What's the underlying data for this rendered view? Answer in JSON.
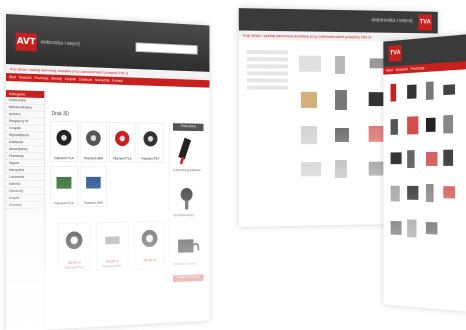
{
  "brand": {
    "logo_text": "AVT",
    "tagline": "elektronika i więcej",
    "badge": "TVA",
    "colors": {
      "accent": "#c8201e",
      "header": "#3a3a3a"
    }
  },
  "left_page": {
    "promo": "Kup teraz i zyskaj darmową dostawę przy zamówieniach powyżej 150 zł",
    "nav": [
      "Start",
      "Nowości",
      "Promocje",
      "Moduły",
      "Czujniki",
      "Zasilacze",
      "Narzędzia",
      "Kontakt"
    ],
    "sidebar_title": "Kategorie",
    "sidebar_items": [
      "Elektronika",
      "Mikrokontrolery",
      "Arduino",
      "Raspberry Pi",
      "Czujniki",
      "Wyświetlacze",
      "Zasilacze",
      "Akumulatory",
      "Przewody",
      "Złącza",
      "Narzędzia",
      "Lutowanie",
      "Mierniki",
      "Obudowy",
      "Książki",
      "Zestawy"
    ],
    "section_title": "Druk 3D",
    "products": [
      {
        "name": "Filament PLA",
        "price": "49,90 zł"
      },
      {
        "name": "Filament ABS",
        "price": "54,90 zł"
      },
      {
        "name": "Filament PLA",
        "price": "49,90 zł"
      },
      {
        "name": "Filament PET",
        "price": "59,90 zł"
      },
      {
        "name": "Filament PLA",
        "price": "49,90 zł"
      },
      {
        "name": "Filament ABS",
        "price": "54,90 zł"
      },
      {
        "name": "Filament PLA",
        "price": "49,90 zł"
      },
      {
        "name": "Filament PET",
        "price": "59,90 zł"
      }
    ],
    "right_box_title": "Polecamy",
    "right_items": [
      "Lutownica grzałkowa",
      "Oprawka lampy",
      "Zasilacz sieciowy"
    ],
    "button_label": "Dodaj do koszyka"
  },
  "right_page": {
    "badge": "TVA",
    "nav": [
      "Start",
      "Nowości",
      "Promocje",
      "Moduły"
    ],
    "sidebar_title": "Kategorie",
    "cart_label": "Koszyk"
  }
}
